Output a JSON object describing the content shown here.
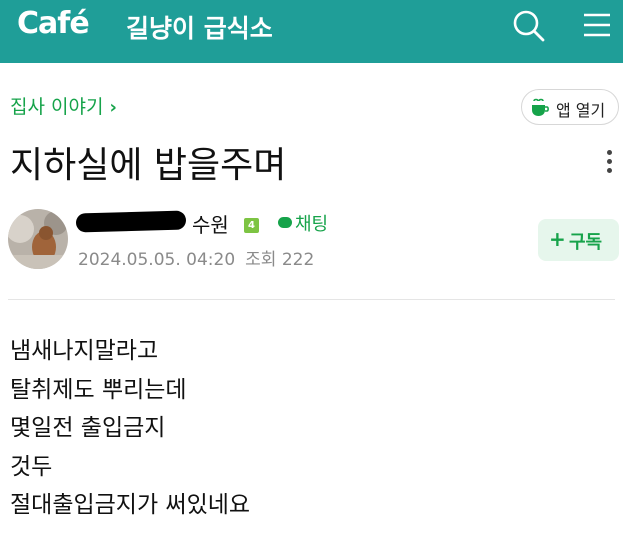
{
  "header": {
    "logo": "Café",
    "cafe_name": "길냥이 급식소"
  },
  "board": {
    "name": "집사 이야기",
    "chevron": "›"
  },
  "open_app_label": "앱 열기",
  "post": {
    "title": "지하실에 밥을주며",
    "author": "수원",
    "level": "4",
    "chat_label": "채팅",
    "date": "2024.05.05. 04:20",
    "views": "조회 222",
    "subscribe_plus": "+",
    "subscribe_label": "구독",
    "body_lines": [
      "냄새나지말라고",
      "탈취제도 뿌리는데",
      "몇일전 출입금지",
      "것두",
      "절대출입금지가 써있네요"
    ]
  },
  "colors": {
    "header_bg": "#1f9e98",
    "accent_green": "#16a34a",
    "subscribe_bg": "#e6f6ec",
    "level_badge": "#7dc443"
  },
  "icons": [
    "search-icon",
    "menu-icon",
    "cup-icon",
    "more-vertical-icon",
    "chat-bubble-icon"
  ]
}
